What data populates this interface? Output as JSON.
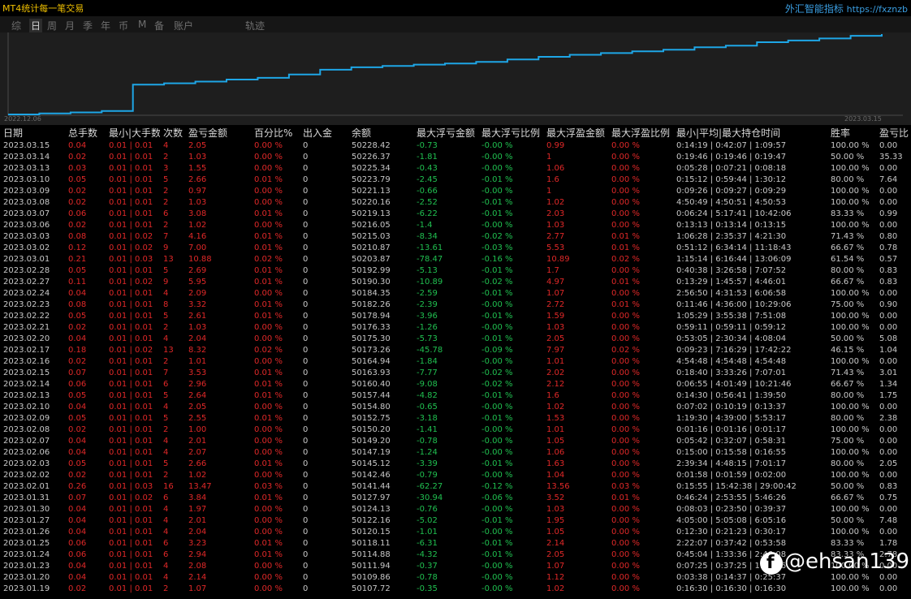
{
  "app_title": "MT4统计每一笔交易",
  "site": {
    "title": "外汇智能指标",
    "url": "https://fxznzb"
  },
  "tabs": [
    {
      "label": "综",
      "active": false
    },
    {
      "label": "日",
      "active": true
    },
    {
      "label": "周",
      "active": false
    },
    {
      "label": "月",
      "active": false
    },
    {
      "label": "季",
      "active": false
    },
    {
      "label": "年",
      "active": false
    },
    {
      "label": "币",
      "active": false
    },
    {
      "label": "M",
      "active": false
    },
    {
      "label": "备",
      "active": false
    },
    {
      "label": "账户",
      "active": false
    },
    {
      "label": "轨迹",
      "active": false
    }
  ],
  "chart_data": {
    "type": "line",
    "x_start_label": "2022.12.06",
    "x_end_label": "2023.03.15",
    "line_color": "#1ea6e6",
    "curve": [
      50000,
      50003,
      50006,
      50010,
      50088,
      50092,
      50097,
      50103,
      50108,
      50118,
      50132,
      50139,
      50143,
      50147,
      50150,
      50155,
      50162,
      50170,
      50176,
      50181,
      50186,
      50191,
      50198,
      50203,
      50213,
      50218,
      50224,
      50232,
      50237
    ]
  },
  "colors": {
    "red": "#e02828",
    "green": "#20c050",
    "text": "#c8c8c8",
    "line": "#1ea6e6"
  },
  "table": {
    "headers": [
      "日期",
      "总手数",
      "最小|大手数",
      "次数",
      "盈亏金额",
      "百分比%",
      "出入金",
      "余额",
      "最大浮亏金额",
      "最大浮亏比例",
      "最大浮盈金额",
      "最大浮盈比例",
      "最小|平均|最大持仓时间",
      "胜率",
      "盈亏比"
    ],
    "rows": [
      [
        "2023.03.15",
        "0.04",
        "0.01 | 0.01",
        "4",
        "2.05",
        "0.00 %",
        "0",
        "50228.42",
        "-0.73",
        "-0.00 %",
        "0.99",
        "0.00 %",
        "0:14:19 | 0:42:07 | 1:09:57",
        "100.00 %",
        "0.00"
      ],
      [
        "2023.03.14",
        "0.02",
        "0.01 | 0.01",
        "2",
        "1.03",
        "0.00 %",
        "0",
        "50226.37",
        "-1.81",
        "-0.00 %",
        "1",
        "0.00 %",
        "0:19:46 | 0:19:46 | 0:19:47",
        "50.00 %",
        "35.33"
      ],
      [
        "2023.03.13",
        "0.03",
        "0.01 | 0.01",
        "3",
        "1.55",
        "0.00 %",
        "0",
        "50225.34",
        "-0.43",
        "-0.00 %",
        "1.06",
        "0.00 %",
        "0:05:28 | 0:07:21 | 0:08:18",
        "100.00 %",
        "0.00"
      ],
      [
        "2023.03.10",
        "0.05",
        "0.01 | 0.01",
        "5",
        "2.66",
        "0.01 %",
        "0",
        "50223.79",
        "-2.45",
        "-0.01 %",
        "1.6",
        "0.00 %",
        "0:15:12 | 0:59:44 | 1:30:12",
        "80.00 %",
        "7.64"
      ],
      [
        "2023.03.09",
        "0.02",
        "0.01 | 0.01",
        "2",
        "0.97",
        "0.00 %",
        "0",
        "50221.13",
        "-0.66",
        "-0.00 %",
        "1",
        "0.00 %",
        "0:09:26 | 0:09:27 | 0:09:29",
        "100.00 %",
        "0.00"
      ],
      [
        "2023.03.08",
        "0.02",
        "0.01 | 0.01",
        "2",
        "1.03",
        "0.00 %",
        "0",
        "50220.16",
        "-2.52",
        "-0.01 %",
        "1.02",
        "0.00 %",
        "4:50:49 | 4:50:51 | 4:50:53",
        "100.00 %",
        "0.00"
      ],
      [
        "2023.03.07",
        "0.06",
        "0.01 | 0.01",
        "6",
        "3.08",
        "0.01 %",
        "0",
        "50219.13",
        "-6.22",
        "-0.01 %",
        "2.03",
        "0.00 %",
        "0:06:24 | 5:17:41 | 10:42:06",
        "83.33 %",
        "0.99"
      ],
      [
        "2023.03.06",
        "0.02",
        "0.01 | 0.01",
        "2",
        "1.02",
        "0.00 %",
        "0",
        "50216.05",
        "-1.4",
        "-0.00 %",
        "1.03",
        "0.00 %",
        "0:13:13 | 0:13:14 | 0:13:15",
        "100.00 %",
        "0.00"
      ],
      [
        "2023.03.03",
        "0.08",
        "0.01 | 0.02",
        "7",
        "4.16",
        "0.01 %",
        "0",
        "50215.03",
        "-8.34",
        "-0.02 %",
        "2.77",
        "0.01 %",
        "1:06:28 | 2:35:37 | 4:21:30",
        "71.43 %",
        "0.80"
      ],
      [
        "2023.03.02",
        "0.12",
        "0.01 | 0.02",
        "9",
        "7.00",
        "0.01 %",
        "0",
        "50210.87",
        "-13.61",
        "-0.03 %",
        "5.53",
        "0.01 %",
        "0:51:12 | 6:34:14 | 11:18:43",
        "66.67 %",
        "0.78"
      ],
      [
        "2023.03.01",
        "0.21",
        "0.01 | 0.03",
        "13",
        "10.88",
        "0.02 %",
        "0",
        "50203.87",
        "-78.47",
        "-0.16 %",
        "10.89",
        "0.02 %",
        "1:15:14 | 6:16:44 | 13:06:09",
        "61.54 %",
        "0.57"
      ],
      [
        "2023.02.28",
        "0.05",
        "0.01 | 0.01",
        "5",
        "2.69",
        "0.01 %",
        "0",
        "50192.99",
        "-5.13",
        "-0.01 %",
        "1.7",
        "0.00 %",
        "0:40:38 | 3:26:58 | 7:07:52",
        "80.00 %",
        "0.83"
      ],
      [
        "2023.02.27",
        "0.11",
        "0.01 | 0.02",
        "9",
        "5.95",
        "0.01 %",
        "0",
        "50190.30",
        "-10.89",
        "-0.02 %",
        "4.97",
        "0.01 %",
        "0:13:29 | 1:45:57 | 4:46:01",
        "66.67 %",
        "0.83"
      ],
      [
        "2023.02.24",
        "0.04",
        "0.01 | 0.01",
        "4",
        "2.09",
        "0.00 %",
        "0",
        "50184.35",
        "-2.59",
        "-0.01 %",
        "1.07",
        "0.00 %",
        "2:56:50 | 4:31:53 | 6:06:58",
        "100.00 %",
        "0.00"
      ],
      [
        "2023.02.23",
        "0.08",
        "0.01 | 0.01",
        "8",
        "3.32",
        "0.01 %",
        "0",
        "50182.26",
        "-2.39",
        "-0.00 %",
        "2.72",
        "0.01 %",
        "0:11:46 | 4:36:00 | 10:29:06",
        "75.00 %",
        "0.90"
      ],
      [
        "2023.02.22",
        "0.05",
        "0.01 | 0.01",
        "5",
        "2.61",
        "0.01 %",
        "0",
        "50178.94",
        "-3.96",
        "-0.01 %",
        "1.59",
        "0.00 %",
        "1:05:29 | 3:55:38 | 7:51:08",
        "100.00 %",
        "0.00"
      ],
      [
        "2023.02.21",
        "0.02",
        "0.01 | 0.01",
        "2",
        "1.03",
        "0.00 %",
        "0",
        "50176.33",
        "-1.26",
        "-0.00 %",
        "1.03",
        "0.00 %",
        "0:59:11 | 0:59:11 | 0:59:12",
        "100.00 %",
        "0.00"
      ],
      [
        "2023.02.20",
        "0.04",
        "0.01 | 0.01",
        "4",
        "2.04",
        "0.00 %",
        "0",
        "50175.30",
        "-5.73",
        "-0.01 %",
        "2.05",
        "0.00 %",
        "0:53:05 | 2:30:34 | 4:08:04",
        "50.00 %",
        "5.08"
      ],
      [
        "2023.02.17",
        "0.18",
        "0.01 | 0.02",
        "13",
        "8.32",
        "0.02 %",
        "0",
        "50173.26",
        "-45.78",
        "-0.09 %",
        "7.97",
        "0.02 %",
        "0:09:23 | 7:16:29 | 17:42:22",
        "46.15 %",
        "1.04"
      ],
      [
        "2023.02.16",
        "0.02",
        "0.01 | 0.01",
        "2",
        "1.01",
        "0.00 %",
        "0",
        "50164.94",
        "-1.84",
        "-0.00 %",
        "1.01",
        "0.00 %",
        "4:54:48 | 4:54:48 | 4:54:48",
        "100.00 %",
        "0.00"
      ],
      [
        "2023.02.15",
        "0.07",
        "0.01 | 0.01",
        "7",
        "3.53",
        "0.01 %",
        "0",
        "50163.93",
        "-7.77",
        "-0.02 %",
        "2.02",
        "0.00 %",
        "0:18:40 | 3:33:26 | 7:07:01",
        "71.43 %",
        "3.01"
      ],
      [
        "2023.02.14",
        "0.06",
        "0.01 | 0.01",
        "6",
        "2.96",
        "0.01 %",
        "0",
        "50160.40",
        "-9.08",
        "-0.02 %",
        "2.12",
        "0.00 %",
        "0:06:55 | 4:01:49 | 10:21:46",
        "66.67 %",
        "1.34"
      ],
      [
        "2023.02.13",
        "0.05",
        "0.01 | 0.01",
        "5",
        "2.64",
        "0.01 %",
        "0",
        "50157.44",
        "-4.82",
        "-0.01 %",
        "1.6",
        "0.00 %",
        "0:14:30 | 0:56:41 | 1:39:50",
        "80.00 %",
        "1.75"
      ],
      [
        "2023.02.10",
        "0.04",
        "0.01 | 0.01",
        "4",
        "2.05",
        "0.00 %",
        "0",
        "50154.80",
        "-0.65",
        "-0.00 %",
        "1.02",
        "0.00 %",
        "0:07:02 | 0:10:19 | 0:13:37",
        "100.00 %",
        "0.00"
      ],
      [
        "2023.02.09",
        "0.05",
        "0.01 | 0.01",
        "5",
        "2.55",
        "0.01 %",
        "0",
        "50152.75",
        "-3.18",
        "-0.01 %",
        "1.53",
        "0.00 %",
        "1:19:30 | 4:39:00 | 5:53:17",
        "80.00 %",
        "2.38"
      ],
      [
        "2023.02.08",
        "0.02",
        "0.01 | 0.01",
        "2",
        "1.00",
        "0.00 %",
        "0",
        "50150.20",
        "-1.41",
        "-0.00 %",
        "1.01",
        "0.00 %",
        "0:01:16 | 0:01:16 | 0:01:17",
        "100.00 %",
        "0.00"
      ],
      [
        "2023.02.07",
        "0.04",
        "0.01 | 0.01",
        "4",
        "2.01",
        "0.00 %",
        "0",
        "50149.20",
        "-0.78",
        "-0.00 %",
        "1.05",
        "0.00 %",
        "0:05:42 | 0:32:07 | 0:58:31",
        "75.00 %",
        "0.00"
      ],
      [
        "2023.02.06",
        "0.04",
        "0.01 | 0.01",
        "4",
        "2.07",
        "0.00 %",
        "0",
        "50147.19",
        "-1.24",
        "-0.00 %",
        "1.06",
        "0.00 %",
        "0:15:00 | 0:15:58 | 0:16:55",
        "100.00 %",
        "0.00"
      ],
      [
        "2023.02.03",
        "0.05",
        "0.01 | 0.01",
        "5",
        "2.66",
        "0.01 %",
        "0",
        "50145.12",
        "-3.39",
        "-0.01 %",
        "1.63",
        "0.00 %",
        "2:39:34 | 4:48:15 | 7:01:17",
        "80.00 %",
        "2.05"
      ],
      [
        "2023.02.02",
        "0.02",
        "0.01 | 0.01",
        "2",
        "1.02",
        "0.00 %",
        "0",
        "50142.46",
        "-0.79",
        "-0.00 %",
        "1.04",
        "0.00 %",
        "0:01:58 | 0:01:59 | 0:02:00",
        "100.00 %",
        "0.00"
      ],
      [
        "2023.02.01",
        "0.26",
        "0.01 | 0.03",
        "16",
        "13.47",
        "0.03 %",
        "0",
        "50141.44",
        "-62.27",
        "-0.12 %",
        "13.56",
        "0.03 %",
        "0:15:55 | 15:42:38 | 29:00:42",
        "50.00 %",
        "0.83"
      ],
      [
        "2023.01.31",
        "0.07",
        "0.01 | 0.02",
        "6",
        "3.84",
        "0.01 %",
        "0",
        "50127.97",
        "-30.94",
        "-0.06 %",
        "3.52",
        "0.01 %",
        "0:46:24 | 2:53:55 | 5:46:26",
        "66.67 %",
        "0.75"
      ],
      [
        "2023.01.30",
        "0.04",
        "0.01 | 0.01",
        "4",
        "1.97",
        "0.00 %",
        "0",
        "50124.13",
        "-0.76",
        "-0.00 %",
        "1.03",
        "0.00 %",
        "0:08:03 | 0:23:50 | 0:39:37",
        "100.00 %",
        "0.00"
      ],
      [
        "2023.01.27",
        "0.04",
        "0.01 | 0.01",
        "4",
        "2.01",
        "0.00 %",
        "0",
        "50122.16",
        "-5.02",
        "-0.01 %",
        "1.95",
        "0.00 %",
        "4:05:00 | 5:05:08 | 6:05:16",
        "50.00 %",
        "7.48"
      ],
      [
        "2023.01.26",
        "0.04",
        "0.01 | 0.01",
        "4",
        "2.04",
        "0.00 %",
        "0",
        "50120.15",
        "-1.01",
        "-0.00 %",
        "1.05",
        "0.00 %",
        "0:12:30 | 0:21:23 | 0:30:17",
        "100.00 %",
        "0.00"
      ],
      [
        "2023.01.25",
        "0.06",
        "0.01 | 0.01",
        "6",
        "3.23",
        "0.01 %",
        "0",
        "50118.11",
        "-6.31",
        "-0.01 %",
        "2.14",
        "0.00 %",
        "2:22:07 | 0:37:42 | 0:53:58",
        "83.33 %",
        "1.78"
      ],
      [
        "2023.01.24",
        "0.06",
        "0.01 | 0.01",
        "6",
        "2.94",
        "0.01 %",
        "0",
        "50114.88",
        "-4.32",
        "-0.01 %",
        "2.05",
        "0.00 %",
        "0:45:04 | 1:33:36 | 2:46:08",
        "83.33 %",
        "2.78"
      ],
      [
        "2023.01.23",
        "0.04",
        "0.01 | 0.01",
        "4",
        "2.08",
        "0.00 %",
        "0",
        "50111.94",
        "-0.37",
        "-0.00 %",
        "1.07",
        "0.00 %",
        "0:07:25 | 0:37:25 | 1:07:26",
        "100.00 %",
        "0.00"
      ],
      [
        "2023.01.20",
        "0.04",
        "0.01 | 0.01",
        "4",
        "2.14",
        "0.00 %",
        "0",
        "50109.86",
        "-0.78",
        "-0.00 %",
        "1.12",
        "0.00 %",
        "0:03:38 | 0:14:37 | 0:25:37",
        "100.00 %",
        "0.00"
      ],
      [
        "2023.01.19",
        "0.02",
        "0.01 | 0.01",
        "2",
        "1.07",
        "0.00 %",
        "0",
        "50107.72",
        "-0.35",
        "-0.00 %",
        "1.02",
        "0.00 %",
        "0:16:30 | 0:16:30 | 0:16:30",
        "100.00 %",
        "0.00"
      ]
    ]
  },
  "watermark": {
    "logo_letter": "f",
    "text": "@ehsan139"
  }
}
